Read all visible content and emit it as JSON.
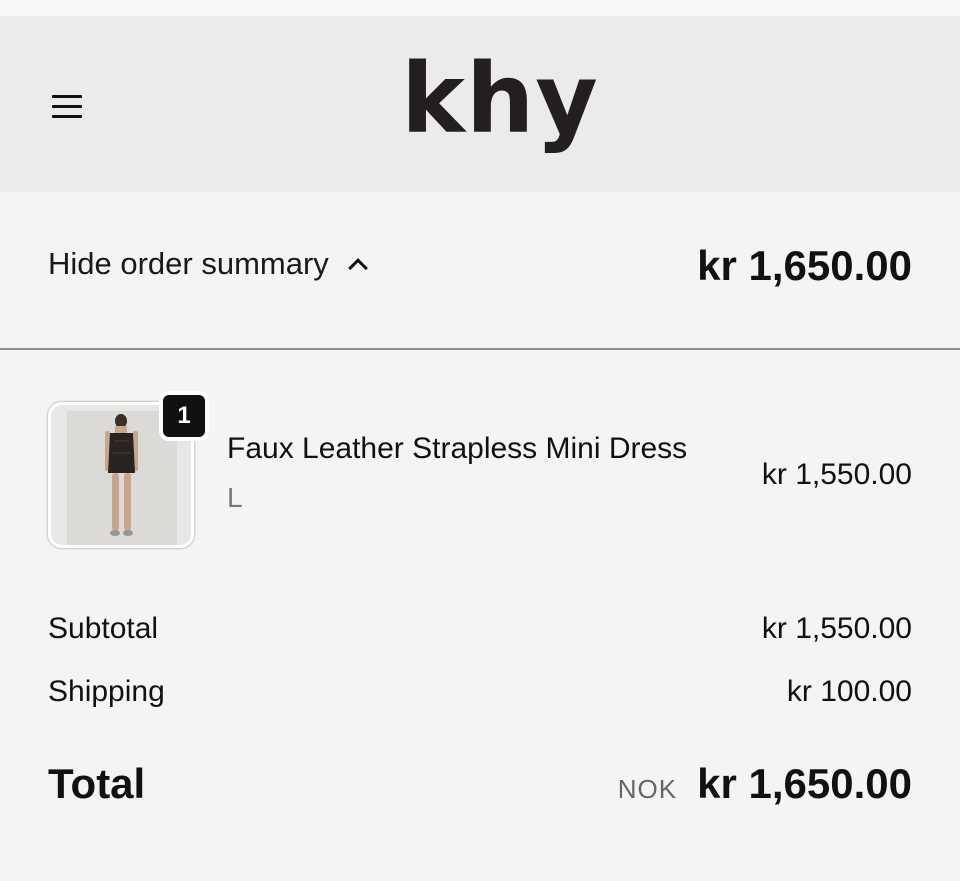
{
  "header": {
    "logo_text": "khy",
    "menu_icon": "hamburger-menu-icon"
  },
  "summary_bar": {
    "toggle_label": "Hide order summary",
    "toggle_icon": "chevron-up-icon",
    "total": "kr 1,650.00"
  },
  "line_items": [
    {
      "quantity": "1",
      "title": "Faux Leather Strapless Mini Dress",
      "variant": "L",
      "price": "kr 1,550.00"
    }
  ],
  "costs": {
    "subtotal_label": "Subtotal",
    "subtotal_value": "kr 1,550.00",
    "shipping_label": "Shipping",
    "shipping_value": "kr 100.00",
    "total_label": "Total",
    "currency": "NOK",
    "total_value": "kr 1,650.00"
  },
  "colors": {
    "header_bg": "#ebebeb",
    "page_bg": "#f4f4f4",
    "text": "#111111",
    "muted_text": "#777777"
  }
}
